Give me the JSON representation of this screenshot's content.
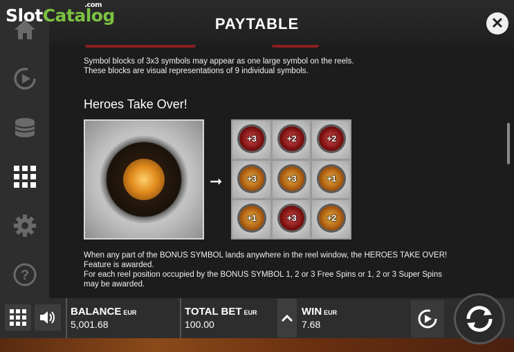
{
  "logo": {
    "slot": "Slot",
    "catalog": "Catalog",
    "com": ".com"
  },
  "header": {
    "title": "PAYTABLE",
    "close_symbol": "✕"
  },
  "sidebar": {
    "items": [
      {
        "icon": "home-icon"
      },
      {
        "icon": "replay-icon"
      },
      {
        "icon": "coins-icon"
      },
      {
        "icon": "grid-icon"
      },
      {
        "icon": "gear-icon"
      },
      {
        "icon": "help-icon"
      }
    ]
  },
  "content": {
    "block_text_1": "Symbol blocks of 3x3 symbols may appear as one large symbol on the reels.",
    "block_text_2": "These blocks are visual representations of 9 individual symbols.",
    "heading": "Heroes Take Over!",
    "arrow": "➞",
    "grid_cells": [
      {
        "label": "+3",
        "color": "red"
      },
      {
        "label": "+2",
        "color": "red"
      },
      {
        "label": "+2",
        "color": "red"
      },
      {
        "label": "+3",
        "color": "orange"
      },
      {
        "label": "+3",
        "color": "orange"
      },
      {
        "label": "+1",
        "color": "orange"
      },
      {
        "label": "+1",
        "color": "orange"
      },
      {
        "label": "+3",
        "color": "red"
      },
      {
        "label": "+2",
        "color": "orange"
      }
    ],
    "desc_1": "When any part of the BONUS SYMBOL lands anywhere in the reel window, the HEROES TAKE OVER!",
    "desc_2": "Feature is awarded.",
    "desc_3": "For each reel position occupied by the BONUS SYMBOL 1, 2 or 3 Free Spins or 1, 2 or 3 Super Spins",
    "desc_4": "may be awarded."
  },
  "bottom": {
    "balance_label": "BALANCE",
    "balance_unit": "EUR",
    "balance_value": "5,001.68",
    "bet_label": "TOTAL BET",
    "bet_unit": "EUR",
    "bet_value": "100.00",
    "win_label": "WIN",
    "win_unit": "EUR",
    "win_value": "7.68"
  },
  "colors": {
    "accent_green": "#7cc242",
    "background": "#1c1c1c",
    "red_orb": "#7a1010",
    "orange_orb": "#a85a10"
  }
}
